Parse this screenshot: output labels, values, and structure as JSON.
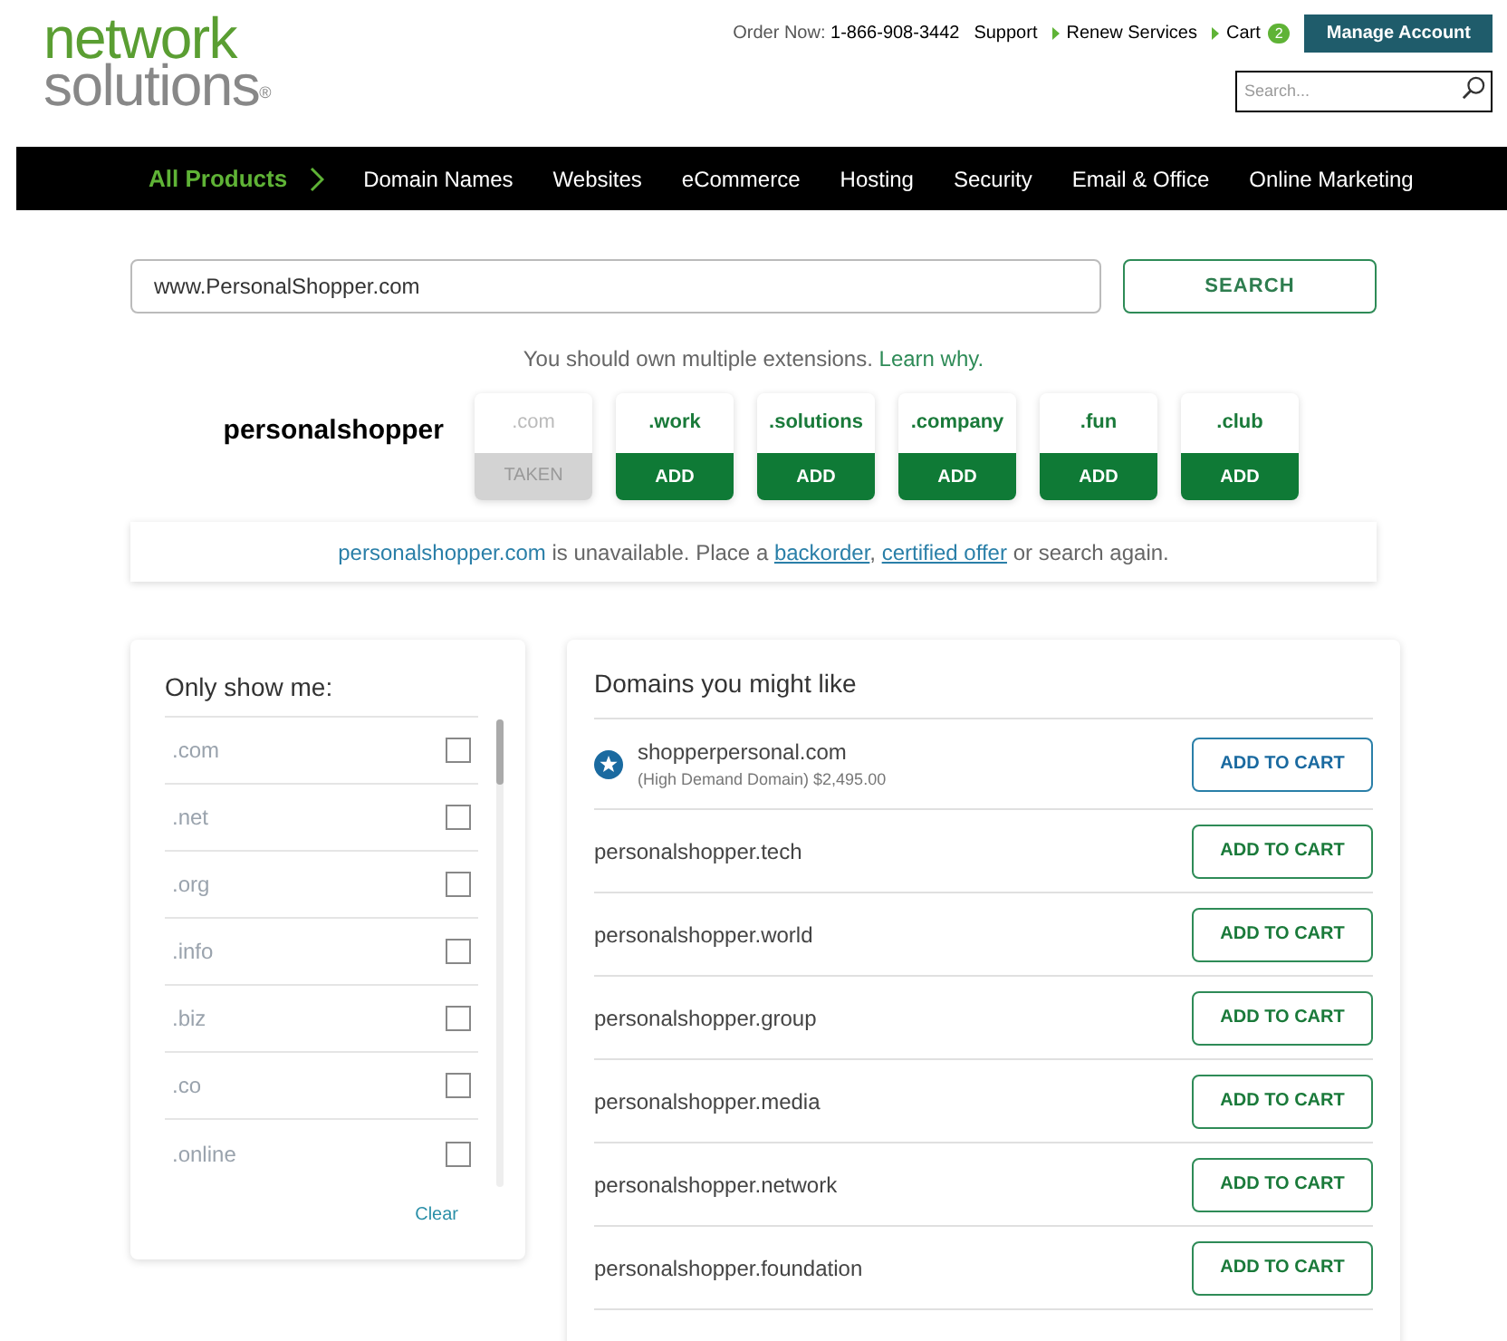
{
  "logo": {
    "line1": "network",
    "line2": "solutions",
    "mark": "®"
  },
  "top_links": {
    "order_label": "Order Now:",
    "phone": "1-866-908-3442",
    "links": [
      "Support",
      "Renew Services",
      "Cart"
    ],
    "cart_count": "2",
    "account_button": "Manage Account",
    "search_placeholder": "Search..."
  },
  "nav": [
    {
      "label": "All Products",
      "selected": true
    },
    {
      "label": "Domain Names",
      "selected": false
    },
    {
      "label": "Websites",
      "selected": false
    },
    {
      "label": "eCommerce",
      "selected": false
    },
    {
      "label": "Hosting",
      "selected": false
    },
    {
      "label": "Security",
      "selected": false
    },
    {
      "label": "Email & Office",
      "selected": false
    },
    {
      "label": "Online Marketing",
      "selected": false
    }
  ],
  "domain_search": {
    "value": "www.PersonalShopper.com",
    "button": "SEARCH"
  },
  "hint": {
    "text": "You should own multiple extensions.",
    "link": "Learn why."
  },
  "name": "personalshopper",
  "extensions": [
    {
      "ext": ".com",
      "action": "TAKEN",
      "kind": "taken"
    },
    {
      "ext": ".work",
      "action": "ADD",
      "kind": "available"
    },
    {
      "ext": ".solutions",
      "action": "ADD",
      "kind": "available"
    },
    {
      "ext": ".company",
      "action": "ADD",
      "kind": "available"
    },
    {
      "ext": ".fun",
      "action": "ADD",
      "kind": "available"
    },
    {
      "ext": ".club",
      "action": "ADD",
      "kind": "available"
    }
  ],
  "notice": {
    "domain": "personalshopper.com",
    "text1": " is unavailable. Place a ",
    "link1": "backorder",
    "sep": ", ",
    "link2": "certified offer",
    "text2": " or search again."
  },
  "filters": {
    "title": "Only show me:",
    "items": [
      {
        "label": ".com",
        "checked": false
      },
      {
        "label": ".net",
        "checked": false
      },
      {
        "label": ".org",
        "checked": false
      },
      {
        "label": ".info",
        "checked": false
      },
      {
        "label": ".biz",
        "checked": false
      },
      {
        "label": ".co",
        "checked": false
      },
      {
        "label": ".online",
        "checked": false
      }
    ],
    "clear": "Clear"
  },
  "suggestions": {
    "title": "Domains you might like",
    "items": [
      {
        "domain": "shopperpersonal.com",
        "note": "(High Demand Domain) $2,495.00",
        "kind": "premium",
        "button": "ADD TO CART"
      },
      {
        "domain": "personalshopper.tech",
        "kind": "standard",
        "button": "ADD TO CART"
      },
      {
        "domain": "personalshopper.world",
        "kind": "standard",
        "button": "ADD TO CART"
      },
      {
        "domain": "personalshopper.group",
        "kind": "standard",
        "button": "ADD TO CART"
      },
      {
        "domain": "personalshopper.media",
        "kind": "standard",
        "button": "ADD TO CART"
      },
      {
        "domain": "personalshopper.network",
        "kind": "standard",
        "button": "ADD TO CART"
      },
      {
        "domain": "personalshopper.foundation",
        "kind": "standard",
        "button": "ADD TO CART"
      }
    ]
  }
}
